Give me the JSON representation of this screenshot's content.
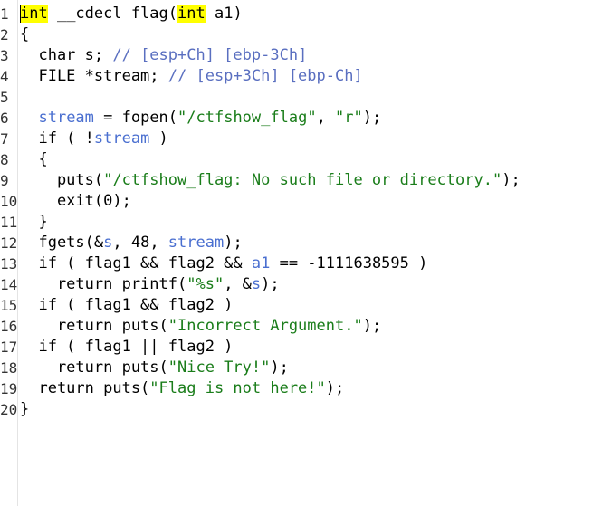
{
  "lines": [
    {
      "n": "1",
      "segments": [
        {
          "t": "int",
          "c": "hl"
        },
        {
          "t": " __cdecl flag(",
          "c": ""
        },
        {
          "t": "int",
          "c": "hl"
        },
        {
          "t": " a1)",
          "c": ""
        }
      ]
    },
    {
      "n": "2",
      "segments": [
        {
          "t": "{",
          "c": ""
        }
      ]
    },
    {
      "n": "3",
      "segments": [
        {
          "t": "  char s; ",
          "c": ""
        },
        {
          "t": "// [esp+Ch] [ebp-3Ch]",
          "c": "cmt"
        }
      ]
    },
    {
      "n": "4",
      "segments": [
        {
          "t": "  FILE *stream; ",
          "c": ""
        },
        {
          "t": "// [esp+3Ch] [ebp-Ch]",
          "c": "cmt"
        }
      ]
    },
    {
      "n": "5",
      "segments": []
    },
    {
      "n": "6",
      "segments": [
        {
          "t": "  ",
          "c": ""
        },
        {
          "t": "stream",
          "c": "var"
        },
        {
          "t": " = fopen(",
          "c": ""
        },
        {
          "t": "\"/ctfshow_flag\"",
          "c": "str"
        },
        {
          "t": ", ",
          "c": ""
        },
        {
          "t": "\"r\"",
          "c": "str"
        },
        {
          "t": ");",
          "c": ""
        }
      ]
    },
    {
      "n": "7",
      "segments": [
        {
          "t": "  if ( !",
          "c": ""
        },
        {
          "t": "stream",
          "c": "var"
        },
        {
          "t": " )",
          "c": ""
        }
      ]
    },
    {
      "n": "8",
      "segments": [
        {
          "t": "  {",
          "c": ""
        }
      ]
    },
    {
      "n": "9",
      "segments": [
        {
          "t": "    puts(",
          "c": ""
        },
        {
          "t": "\"/ctfshow_flag: No such file or directory.\"",
          "c": "str"
        },
        {
          "t": ");",
          "c": ""
        }
      ]
    },
    {
      "n": "10",
      "segments": [
        {
          "t": "    exit(0);",
          "c": ""
        }
      ]
    },
    {
      "n": "11",
      "segments": [
        {
          "t": "  }",
          "c": ""
        }
      ]
    },
    {
      "n": "12",
      "segments": [
        {
          "t": "  fgets(&",
          "c": ""
        },
        {
          "t": "s",
          "c": "var"
        },
        {
          "t": ", 48, ",
          "c": ""
        },
        {
          "t": "stream",
          "c": "var"
        },
        {
          "t": ");",
          "c": ""
        }
      ]
    },
    {
      "n": "13",
      "segments": [
        {
          "t": "  if ( flag1 && flag2 && ",
          "c": ""
        },
        {
          "t": "a1",
          "c": "var"
        },
        {
          "t": " == -1111638595 )",
          "c": ""
        }
      ]
    },
    {
      "n": "14",
      "segments": [
        {
          "t": "    return printf(",
          "c": ""
        },
        {
          "t": "\"%s\"",
          "c": "str"
        },
        {
          "t": ", &",
          "c": ""
        },
        {
          "t": "s",
          "c": "var"
        },
        {
          "t": ");",
          "c": ""
        }
      ]
    },
    {
      "n": "15",
      "segments": [
        {
          "t": "  if ( flag1 && flag2 )",
          "c": ""
        }
      ]
    },
    {
      "n": "16",
      "segments": [
        {
          "t": "    return puts(",
          "c": ""
        },
        {
          "t": "\"Incorrect Argument.\"",
          "c": "str"
        },
        {
          "t": ");",
          "c": ""
        }
      ]
    },
    {
      "n": "17",
      "segments": [
        {
          "t": "  if ( flag1 || flag2 )",
          "c": ""
        }
      ]
    },
    {
      "n": "18",
      "segments": [
        {
          "t": "    return puts(",
          "c": ""
        },
        {
          "t": "\"Nice Try!\"",
          "c": "str"
        },
        {
          "t": ");",
          "c": ""
        }
      ]
    },
    {
      "n": "19",
      "segments": [
        {
          "t": "  return puts(",
          "c": ""
        },
        {
          "t": "\"Flag is not here!\"",
          "c": "str"
        },
        {
          "t": ");",
          "c": ""
        }
      ]
    },
    {
      "n": "20",
      "segments": [
        {
          "t": "}",
          "c": ""
        }
      ]
    }
  ]
}
